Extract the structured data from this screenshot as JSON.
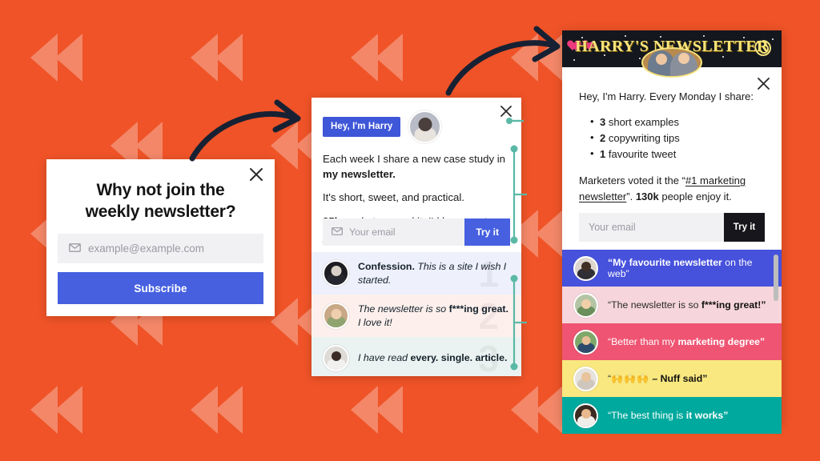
{
  "theme": {
    "background_color": "#EF5327",
    "accent_blue": "#4660E0",
    "badge_blue": "#3E56D8",
    "banner_dark": "#15171E",
    "banner_yellow": "#F5E37C",
    "heart_pink": "#ED3A7E",
    "teal_marker": "#5AB8A6",
    "arrow_navy": "#182133"
  },
  "card_simple": {
    "name": "Simple newsletter modal",
    "close_label": "×",
    "title": "Why not join the weekly newsletter?",
    "email_placeholder": "example@example.com",
    "email_value": "",
    "submit_label": "Subscribe",
    "icon": "envelope-icon"
  },
  "card_middle": {
    "name": "Harry newsletter widget",
    "close_label": "×",
    "badge_label": "Hey, I'm Harry",
    "avatar": "harry-avatar",
    "paragraphs": [
      {
        "text_before": "Each week I share a new case study in ",
        "bold": "my newsletter.",
        "text_after": ""
      },
      {
        "text_before": "It's short, sweet, and practical.",
        "bold": "",
        "text_after": ""
      },
      {
        "text_before": "",
        "bold": "25k",
        "text_after": " marketers read it. I'd love you to join."
      }
    ],
    "email_placeholder": "Your email",
    "email_value": "",
    "submit_label": "Try it",
    "quotes": [
      {
        "lead": "Confession.",
        "italic": " This is a site I wish I started.",
        "bold": "",
        "tail": "",
        "ghost": "1",
        "avatar": "quote-avatar-1"
      },
      {
        "lead": "",
        "italic": "The newsletter is so ",
        "bold": "f***ing great.",
        "tail": " I love it!",
        "ghost": "2",
        "avatar": "quote-avatar-2"
      },
      {
        "lead": "",
        "italic": "I have read ",
        "bold": "every. single. article.",
        "tail": "",
        "ghost": "3",
        "avatar": "quote-avatar-3"
      }
    ]
  },
  "card_phone": {
    "name": "Harry's Newsletter full popup",
    "banner_title": "HARRY'S NEWSLETTER",
    "banner_icons": [
      "heart-icon",
      "heart-icon",
      "spiral-icon"
    ],
    "banner_photo": "harry-and-friend-photo",
    "close_label": "×",
    "lead": "Hey, I'm Harry. Every Monday I share:",
    "bullets": [
      {
        "bold": "3",
        "rest": " short examples"
      },
      {
        "bold": "2",
        "rest": " copywriting tips"
      },
      {
        "bold": "1",
        "rest": " favourite tweet"
      }
    ],
    "vote_prefix": "Marketers voted it the “",
    "vote_underlined": "#1 marketing newsletter",
    "vote_mid": "”. ",
    "vote_bold": "130k",
    "vote_suffix": " people enjoy it.",
    "email_placeholder": "Your email",
    "email_value": "",
    "submit_label": "Try it",
    "testimonials": [
      {
        "prefix": "“My favourite newsletter",
        "bold_first": true,
        "bold": "My favourite newsletter",
        "rest": " on the web”",
        "bg": "#4651DC",
        "text_light": true,
        "avatar": "testimonial-avatar-1"
      },
      {
        "prefix": "“The newsletter is so ",
        "bold": "f***ing great!”",
        "rest": "",
        "bg": "#F6D6DC",
        "text_light": false,
        "avatar": "testimonial-avatar-2"
      },
      {
        "prefix": "“Better than my ",
        "bold": "marketing degree”",
        "rest": "",
        "bg": "#EF5472",
        "text_light": true,
        "avatar": "testimonial-avatar-3"
      },
      {
        "prefix": "“",
        "emoji": "🙌🙌🙌",
        "bold": " – Nuff said”",
        "rest": "",
        "bg": "#F9E87F",
        "text_light": false,
        "avatar": "testimonial-avatar-4"
      },
      {
        "prefix": "“The best thing is ",
        "bold": "it works”",
        "rest": "",
        "bg": "#00A99D",
        "text_light": true,
        "avatar": "testimonial-avatar-5"
      }
    ],
    "scrollbar": "vertical-scrollbar"
  },
  "annotations": {
    "arrow_1": "curved-arrow-pointing-right",
    "arrow_2": "curved-arrow-pointing-right",
    "brackets": [
      "measure-bracket",
      "measure-bracket",
      "measure-bracket"
    ]
  }
}
